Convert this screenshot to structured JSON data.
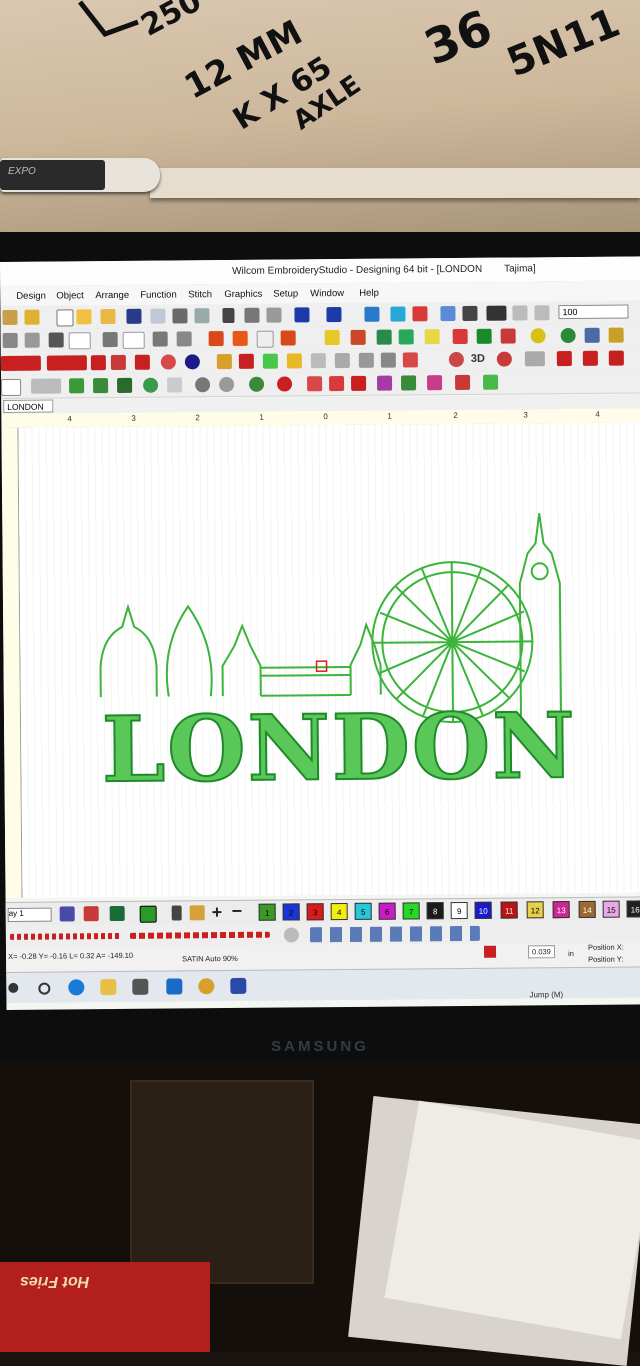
{
  "whiteboard": {
    "notes": [
      "250",
      "12 MM",
      "K X 65",
      "AXLE",
      "36",
      "5N11"
    ],
    "marker_brand": "EXPO"
  },
  "window": {
    "title": "Wilcom EmbroideryStudio - Designing 64 bit - [LONDON",
    "machine": "Tajima]"
  },
  "menu": [
    "Design",
    "Object",
    "Arrange",
    "Function",
    "Stitch",
    "Graphics",
    "Setup",
    "Window",
    "Help"
  ],
  "toolbar": {
    "zoom_value": "100",
    "text_3d": "3D"
  },
  "tab": {
    "label": "LONDON"
  },
  "ruler": {
    "ticks": [
      "4",
      "3",
      "2",
      "1",
      "0",
      "1",
      "2",
      "3",
      "4"
    ]
  },
  "design": {
    "text": "LONDON",
    "thread_color": "#3cb43c"
  },
  "palette": {
    "view_label": "ay 1",
    "swatches": [
      {
        "num": "1",
        "color": "#3a9a28"
      },
      {
        "num": "2",
        "color": "#1c36d6"
      },
      {
        "num": "3",
        "color": "#d81c1c"
      },
      {
        "num": "4",
        "color": "#f2ec12"
      },
      {
        "num": "5",
        "color": "#28c8d8"
      },
      {
        "num": "6",
        "color": "#c81cc8"
      },
      {
        "num": "7",
        "color": "#28d828"
      },
      {
        "num": "8",
        "color": "#1a1a1a"
      },
      {
        "num": "9",
        "color": "#ffffff"
      },
      {
        "num": "10",
        "color": "#1a1ac8"
      },
      {
        "num": "11",
        "color": "#b81414"
      },
      {
        "num": "12",
        "color": "#e8d04a"
      },
      {
        "num": "13",
        "color": "#c82890"
      },
      {
        "num": "14",
        "color": "#9a6a32"
      },
      {
        "num": "15",
        "color": "#e8a8e8"
      },
      {
        "num": "16",
        "color": "#202020"
      }
    ]
  },
  "status": {
    "coords": "X= -0.28 Y= -0.16 L= 0.32 A= -149.10",
    "stitch_type": "SATIN Auto 90%",
    "spacing": "0.039",
    "unit": "in",
    "position_x": "Position X:",
    "position_y": "Position Y:",
    "jump": "Jump (M)"
  },
  "monitor": {
    "brand": "SAMSUNG"
  },
  "snack": {
    "brand": "Hot Fries"
  }
}
